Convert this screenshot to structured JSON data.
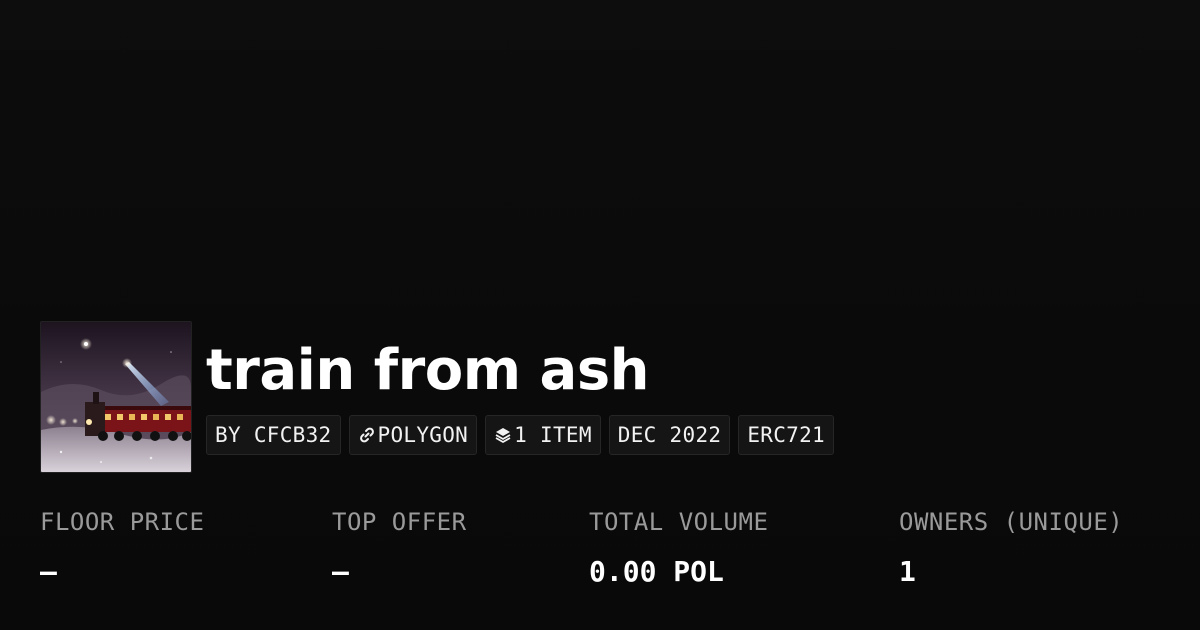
{
  "collection": {
    "title": "train from ash"
  },
  "tags": [
    {
      "label": "BY CFCB32",
      "icon": null
    },
    {
      "label": "POLYGON",
      "icon": "chain-link-icon"
    },
    {
      "label": "1 ITEM",
      "icon": "layers-icon"
    },
    {
      "label": "DEC 2022",
      "icon": null
    },
    {
      "label": "ERC721",
      "icon": null
    }
  ],
  "stats": [
    {
      "label": "FLOOR PRICE",
      "value": "–"
    },
    {
      "label": "TOP OFFER",
      "value": "–"
    },
    {
      "label": "TOTAL VOLUME",
      "value": "0.00 POL"
    },
    {
      "label": "OWNERS (UNIQUE)",
      "value": "1"
    }
  ],
  "colors": {
    "background": "#0b0b0b",
    "text": "#ffffff",
    "muted": "#9a9a9a",
    "tag_bg": "#151515",
    "tag_border": "#262626"
  }
}
